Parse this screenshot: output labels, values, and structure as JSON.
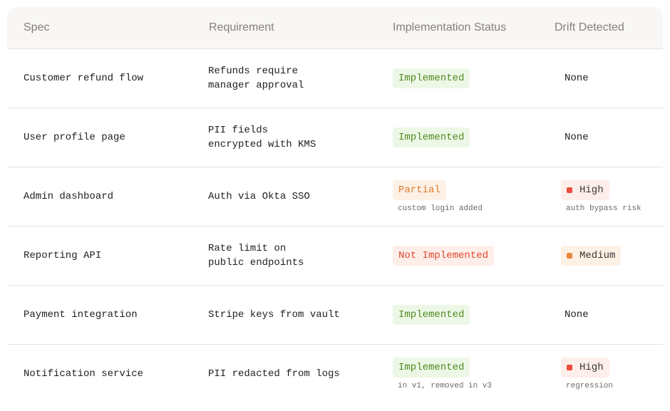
{
  "headers": {
    "spec": "Spec",
    "requirement": "Requirement",
    "status": "Implementation Status",
    "drift": "Drift Detected"
  },
  "rows": [
    {
      "spec": "Customer refund flow",
      "requirement": "Refunds require\nmanager approval",
      "status": "Implemented",
      "status_note": "",
      "drift": "None",
      "drift_note": ""
    },
    {
      "spec": "User profile page",
      "requirement": "PII fields\nencrypted with KMS",
      "status": "Implemented",
      "status_note": "",
      "drift": "None",
      "drift_note": ""
    },
    {
      "spec": "Admin dashboard",
      "requirement": "Auth via Okta SSO",
      "status": "Partial",
      "status_note": "custom login added",
      "drift": "High",
      "drift_note": "auth bypass risk"
    },
    {
      "spec": "Reporting API",
      "requirement": "Rate limit on\npublic endpoints",
      "status": "Not Implemented",
      "status_note": "",
      "drift": "Medium",
      "drift_note": ""
    },
    {
      "spec": "Payment integration",
      "requirement": "Stripe keys from vault",
      "status": "Implemented",
      "status_note": "",
      "drift": "None",
      "drift_note": ""
    },
    {
      "spec": "Notification service",
      "requirement": "PII redacted from logs",
      "status": "Implemented",
      "status_note": "in v1, removed in v3",
      "drift": "High",
      "drift_note": "regression"
    }
  ],
  "colors": {
    "implemented": "#4d8a1f",
    "partial": "#e07a2a",
    "not_implemented": "#e0482f",
    "high": "#ea4b3a",
    "medium": "#e8873a"
  }
}
